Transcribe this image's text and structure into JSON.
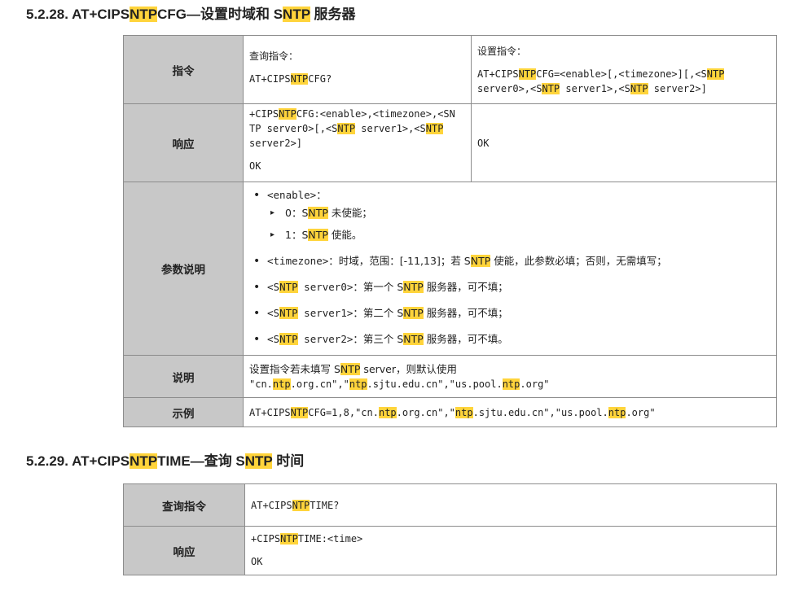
{
  "section1": {
    "heading": {
      "pre": "5.2.28. AT+CIPS",
      "hl": "NTP",
      "post": "CFG—设置时域和 S",
      "hl2": "NTP",
      "post2": " 服务器"
    },
    "labels": {
      "cmd": "指令",
      "resp": "响应",
      "params": "参数说明",
      "note": "说明",
      "example": "示例"
    },
    "query": {
      "title": "查询指令：",
      "cmd_pre": "AT+CIPS",
      "cmd_hl": "NTP",
      "cmd_post": "CFG?"
    },
    "set": {
      "title": "设置指令：",
      "l1a": "AT+CIPS",
      "l1b": "NTP",
      "l1c": "CFG=<enable>[,<timezone>][,<S",
      "l1d": "NTP",
      "l2a": "server0>,<S",
      "l2b": "NTP",
      "l2c": " server1>,<S",
      "l2d": "NTP",
      "l2e": " server2>]"
    },
    "query_resp": {
      "a": "+CIPS",
      "b": "NTP",
      "c": "CFG:<enable>,<timezone>,<SN",
      "d": "TP server0>[,<S",
      "e": "NTP",
      "f": " server1>,<S",
      "g": "NTP",
      "h": "server2>]",
      "ok": "OK"
    },
    "set_resp": "OK",
    "params": {
      "enable": "<enable>：",
      "enable0_pre": "0：S",
      "enable0_hl": "NTP",
      "enable0_post": " 未使能；",
      "enable1_pre": "1：S",
      "enable1_hl": "NTP",
      "enable1_post": " 使能。",
      "tz_a": "<timezone>：",
      "tz_b": "时域，范围：[-11,13]；若 S",
      "tz_hl": "NTP",
      "tz_c": " 使能，此参数必填；否则，无需填写；",
      "s0_a": "<S",
      "s0_hl": "NTP",
      "s0_b": " server0>：",
      "s0_c": "第一个 S",
      "s0_hl2": "NTP",
      "s0_d": " 服务器，可不填；",
      "s1_a": "<S",
      "s1_hl": "NTP",
      "s1_b": " server1>：",
      "s1_c": "第二个 S",
      "s1_hl2": "NTP",
      "s1_d": " 服务器，可不填；",
      "s2_a": "<S",
      "s2_hl": "NTP",
      "s2_b": " server2>：",
      "s2_c": "第三个 S",
      "s2_hl2": "NTP",
      "s2_d": " 服务器，可不填。"
    },
    "note": {
      "a": "设置指令若未填写 S",
      "hl": "NTP",
      "b": " server，则默认使用",
      "c": "\"cn.",
      "hl2": "ntp",
      "d": ".org.cn\",\"",
      "hl3": "ntp",
      "e": ".sjtu.edu.cn\",\"us.pool.",
      "hl4": "ntp",
      "f": ".org\""
    },
    "example": {
      "a": "AT+CIPS",
      "hl": "NTP",
      "b": "CFG=1,8,\"cn.",
      "hl2": "ntp",
      "c": ".org.cn\",\"",
      "hl3": "ntp",
      "d": ".sjtu.edu.cn\",\"us.pool.",
      "hl4": "ntp",
      "e": ".org\""
    }
  },
  "section2": {
    "heading": {
      "pre": "5.2.29. AT+CIPS",
      "hl": "NTP",
      "post": "TIME—查询 S",
      "hl2": "NTP",
      "post2": " 时间"
    },
    "labels": {
      "query": "查询指令",
      "resp": "响应"
    },
    "query": {
      "a": "AT+CIPS",
      "hl": "NTP",
      "b": "TIME?"
    },
    "resp": {
      "a": "+CIPS",
      "hl": "NTP",
      "b": "TIME:<time>",
      "ok": "OK"
    }
  }
}
